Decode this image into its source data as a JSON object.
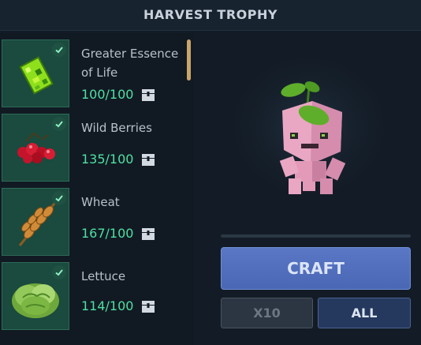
{
  "header": {
    "title": "HARVEST TROPHY"
  },
  "materials": [
    {
      "name": "Greater Essence of Life",
      "quantity": "100/100",
      "icon": "essence-of-life-icon",
      "complete": true
    },
    {
      "name": "Wild Berries",
      "quantity": "135/100",
      "icon": "wild-berries-icon",
      "complete": true
    },
    {
      "name": "Wheat",
      "quantity": "167/100",
      "icon": "wheat-icon",
      "complete": true
    },
    {
      "name": "Lettuce",
      "quantity": "114/100",
      "icon": "lettuce-icon",
      "complete": true
    }
  ],
  "preview": {
    "icon": "harvest-trophy-creature-icon"
  },
  "actions": {
    "craft_label": "CRAFT",
    "x10_label": "X10",
    "all_label": "ALL"
  },
  "colors": {
    "background": "#131c26",
    "quantity_green": "#4fe0a2",
    "craft_blue": "#5a77c6",
    "scrollbar_gold": "#c9a56b"
  }
}
